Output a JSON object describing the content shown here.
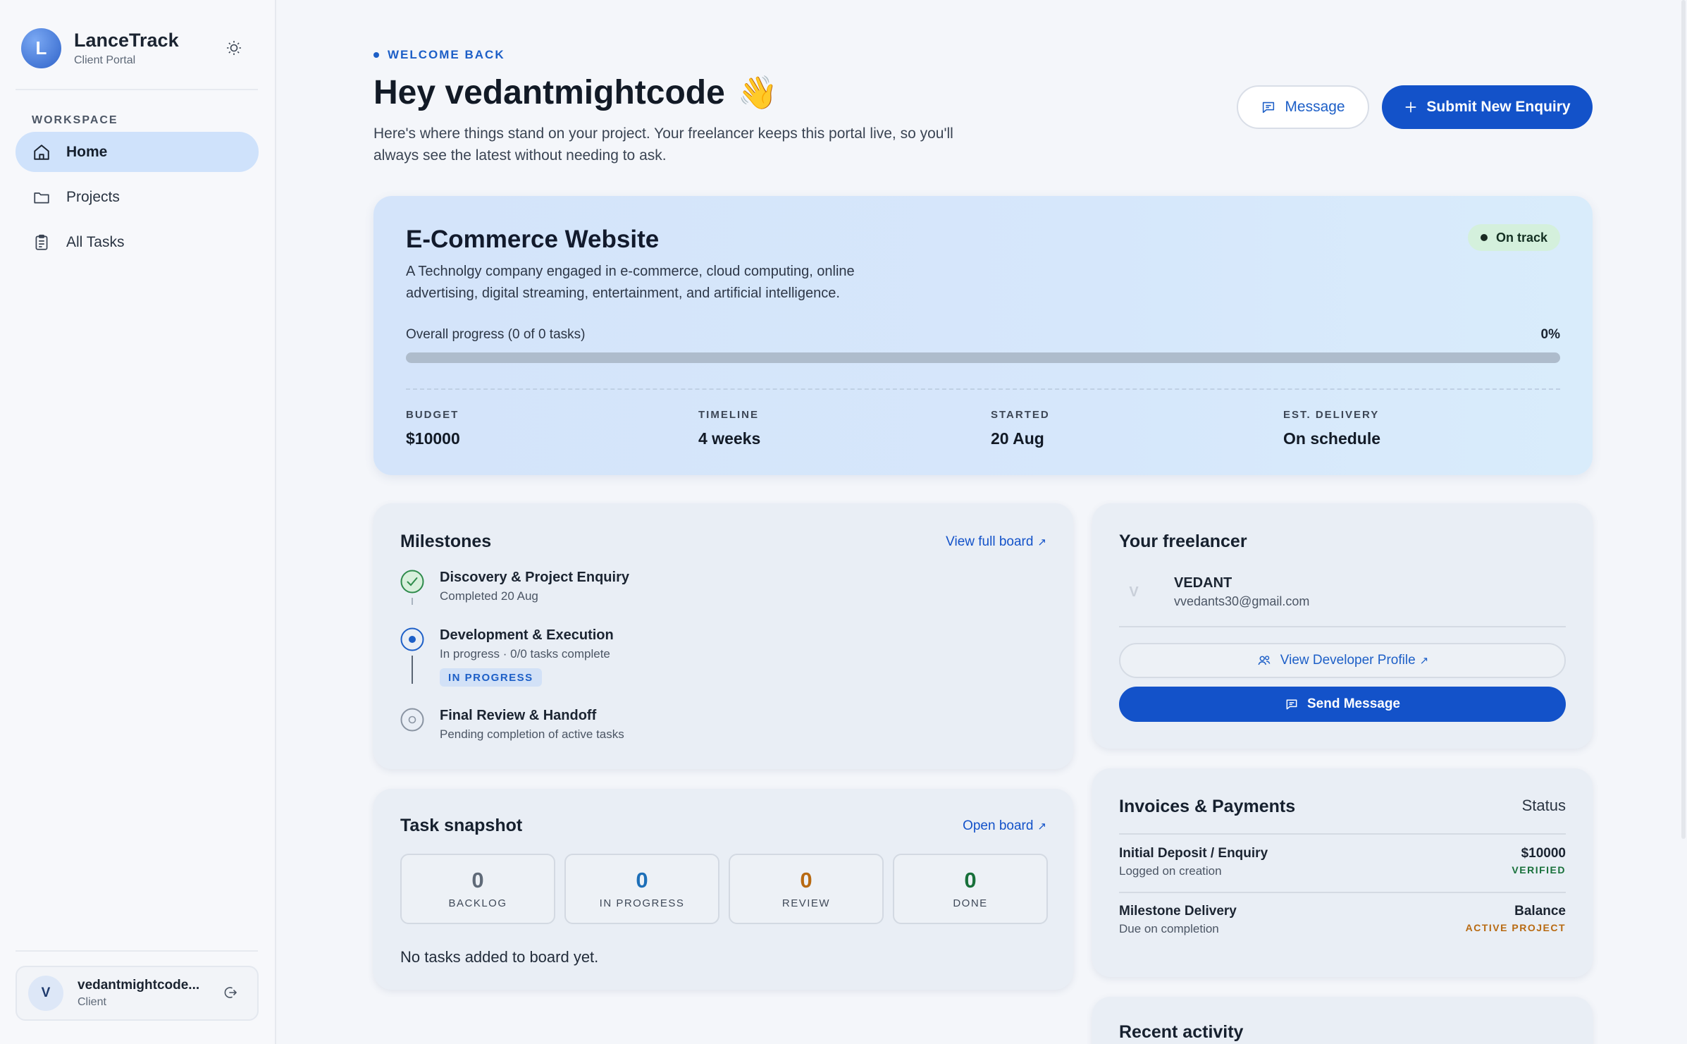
{
  "brand": {
    "logo_letter": "L",
    "name": "LanceTrack",
    "subtitle": "Client Portal"
  },
  "sidebar": {
    "section_label": "WORKSPACE",
    "items": [
      {
        "label": "Home",
        "icon": "home-icon",
        "active": true
      },
      {
        "label": "Projects",
        "icon": "folder-icon",
        "active": false
      },
      {
        "label": "All Tasks",
        "icon": "clipboard-icon",
        "active": false
      }
    ],
    "user": {
      "initial": "V",
      "name": "vedantmightcode...",
      "role": "Client"
    }
  },
  "header": {
    "eyebrow": "WELCOME BACK",
    "greeting": "Hey vedantmightcode",
    "wave": "👋",
    "intro": "Here's where things stand on your project. Your freelancer keeps this portal live, so you'll always see the latest without needing to ask.",
    "message_label": "Message",
    "submit_label": "Submit New Enquiry"
  },
  "project": {
    "title": "E-Commerce Website",
    "status": "On track",
    "description": "A Technolgy company engaged in e-commerce, cloud computing, online advertising, digital streaming, entertainment, and artificial intelligence.",
    "progress_label": "Overall progress (0 of 0 tasks)",
    "progress_text": "0%",
    "progress_value": 0,
    "stats": [
      {
        "label": "BUDGET",
        "value": "$10000"
      },
      {
        "label": "TIMELINE",
        "value": "4 weeks"
      },
      {
        "label": "STARTED",
        "value": "20 Aug"
      },
      {
        "label": "EST. DELIVERY",
        "value": "On schedule"
      }
    ]
  },
  "milestones": {
    "title": "Milestones",
    "link": "View full board",
    "items": [
      {
        "title": "Discovery & Project Enquiry",
        "sub": "Completed 20 Aug",
        "state": "done"
      },
      {
        "title": "Development & Execution",
        "sub": "In progress · 0/0 tasks complete",
        "badge": "IN PROGRESS",
        "state": "active"
      },
      {
        "title": "Final Review & Handoff",
        "sub": "Pending completion of active tasks",
        "state": "pending"
      }
    ]
  },
  "tasks": {
    "title": "Task snapshot",
    "link": "Open board",
    "tiles": [
      {
        "count": "0",
        "label": "BACKLOG",
        "color": "#5f6a78"
      },
      {
        "count": "0",
        "label": "IN PROGRESS",
        "color": "#1d6fb8"
      },
      {
        "count": "0",
        "label": "REVIEW",
        "color": "#b86a12"
      },
      {
        "count": "0",
        "label": "DONE",
        "color": "#18703a"
      }
    ],
    "empty": "No tasks added to board yet."
  },
  "freelancer": {
    "title": "Your freelancer",
    "initial": "V",
    "name": "VEDANT",
    "email": "vvedants30@gmail.com",
    "profile_label": "View Developer Profile",
    "send_label": "Send Message"
  },
  "invoices": {
    "title": "Invoices & Payments",
    "status_header": "Status",
    "rows": [
      {
        "name": "Initial Deposit / Enquiry",
        "sub": "Logged on creation",
        "amount": "$10000",
        "tag": "VERIFIED",
        "tag_color": "#18703a"
      },
      {
        "name": "Milestone Delivery",
        "sub": "Due on completion",
        "amount": "Balance",
        "tag": "ACTIVE PROJECT",
        "tag_color": "#b86a12"
      }
    ]
  },
  "activity": {
    "title": "Recent activity"
  }
}
